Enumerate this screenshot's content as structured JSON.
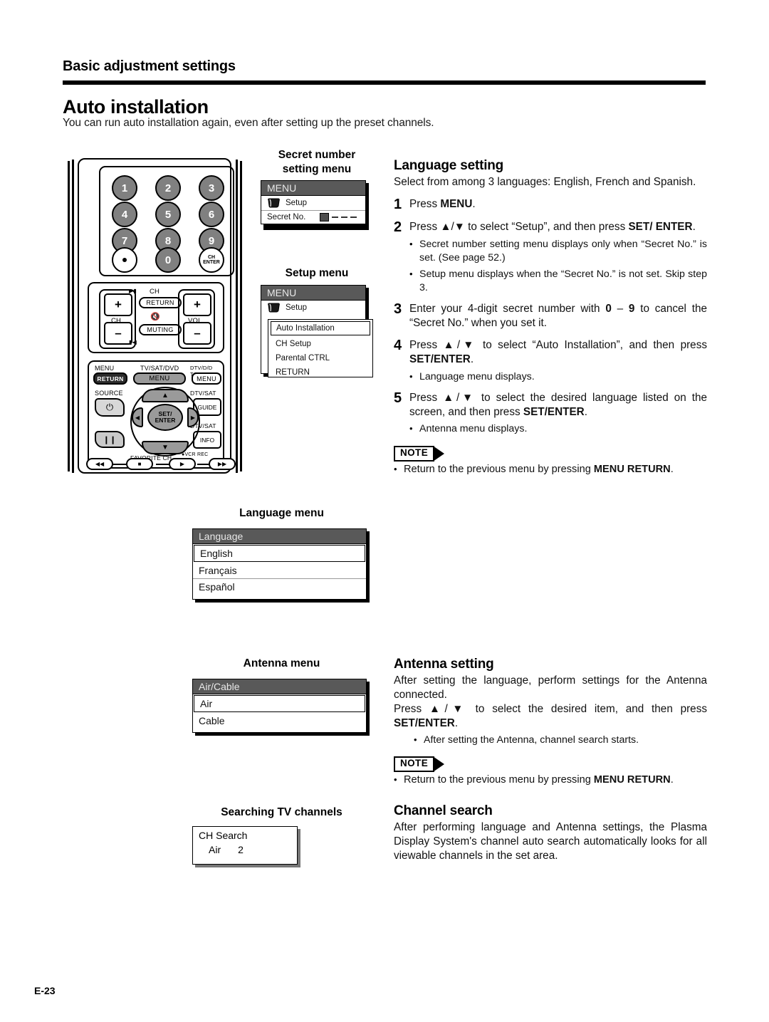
{
  "header": {
    "section": "Basic adjustment settings",
    "title": "Auto installation",
    "subtitle": "You can run auto installation again, even after setting up the preset channels."
  },
  "remote": {
    "keys": [
      "1",
      "2",
      "3",
      "4",
      "5",
      "6",
      "7",
      "8",
      "9",
      "0"
    ],
    "dot_key": "•",
    "ch_enter": [
      "CH",
      "ENTER"
    ],
    "ch_label": "CH",
    "vol_label": "VOL",
    "plus": "+",
    "minus": "–",
    "ch_return": "RETURN",
    "ch_return_top": "CH",
    "muting": "MUTING",
    "menu_return_top": "MENU",
    "menu_return": "RETURN",
    "tv_sat_dvd_top": "TV/SAT/DVD",
    "tv_sat_dvd_menu": "MENU",
    "dtv_dvd_top": "DTV/D/D TOP",
    "dtv_dvd_menu": "MENU",
    "source_label": "SOURCE",
    "power_icon": "power-icon",
    "dtv_sat_guide_top": "DTV/SAT",
    "guide": "GUIDE",
    "dtv_sat_info_top": "DTV/SAT",
    "info": "INFO",
    "set_enter": [
      "SET/",
      "ENTER"
    ],
    "favorite_ch": "FAVORITE CH",
    "vcr_rec": "VCR REC",
    "pause_icon": "pause-icon",
    "transport": [
      "rewind-icon",
      "stop-icon",
      "play-icon",
      "fast-forward-icon"
    ]
  },
  "captions": {
    "secret_menu": [
      "Secret number",
      "setting menu"
    ],
    "setup_menu": "Setup menu",
    "language_menu": "Language menu",
    "antenna_menu": "Antenna menu",
    "searching": "Searching TV channels"
  },
  "osd": {
    "menu_title": "MENU",
    "setup_item": "Setup",
    "secret_no_label": "Secret No.",
    "submenu_items": [
      "Auto Installation",
      "CH Setup",
      "Parental CTRL",
      "RETURN"
    ],
    "submenu_selected": "Auto Installation",
    "language_header": "Language",
    "language_items": [
      "English",
      "Français",
      "Español"
    ],
    "language_selected": "English",
    "antenna_header": "Air/Cable",
    "antenna_items": [
      "Air",
      "Cable"
    ],
    "antenna_selected": "Air",
    "ch_search_title": "CH Search",
    "ch_search_band": "Air",
    "ch_search_num": "2"
  },
  "language_setting": {
    "heading": "Language setting",
    "intro": "Select from among 3 languages: English, French and Spanish.",
    "steps": [
      {
        "n": "1",
        "text_html": "Press <b>MENU</b>."
      },
      {
        "n": "2",
        "text_html": "Press ▲/▼ to select “Setup”, and then press <b>SET/ ENTER</b>."
      },
      {
        "n": "3",
        "text_html": "Enter your 4-digit secret number with <b>0</b> – <b>9</b> to cancel the “Secret No.” when you set it."
      },
      {
        "n": "4",
        "text_html": "Press ▲/▼ to select “Auto Installation”, and then press <b>SET/ENTER</b>."
      },
      {
        "n": "5",
        "text_html": "Press ▲/▼ to select the desired language listed on the screen, and then press <b>SET/ENTER</b>."
      }
    ],
    "bullets_after_2": [
      "Secret number setting menu displays only when “Secret No.” is set. (See page 52.)",
      "Setup menu displays when the “Secret No.” is not set. Skip step 3."
    ],
    "bullet_after_4": "Language menu displays.",
    "bullet_after_5": "Antenna menu displays.",
    "note_label": "NOTE",
    "note_text_html": "Return to the previous menu by pressing <b>MENU RETURN</b>."
  },
  "antenna_setting": {
    "heading": "Antenna setting",
    "para_html": "After setting the language, perform settings for the Antenna connected.<br>Press ▲/▼ to select the desired item, and then press <b>SET/ENTER</b>.",
    "bullet": "After setting the Antenna, channel search starts.",
    "note_label": "NOTE",
    "note_text_html": "Return to the previous menu by pressing <b>MENU RETURN</b>."
  },
  "channel_search": {
    "heading": "Channel search",
    "para": "After performing language and Antenna settings, the Plasma Display System's channel auto search automatically looks for all viewable channels in the set area."
  },
  "footer": {
    "page_number": "E-23"
  }
}
